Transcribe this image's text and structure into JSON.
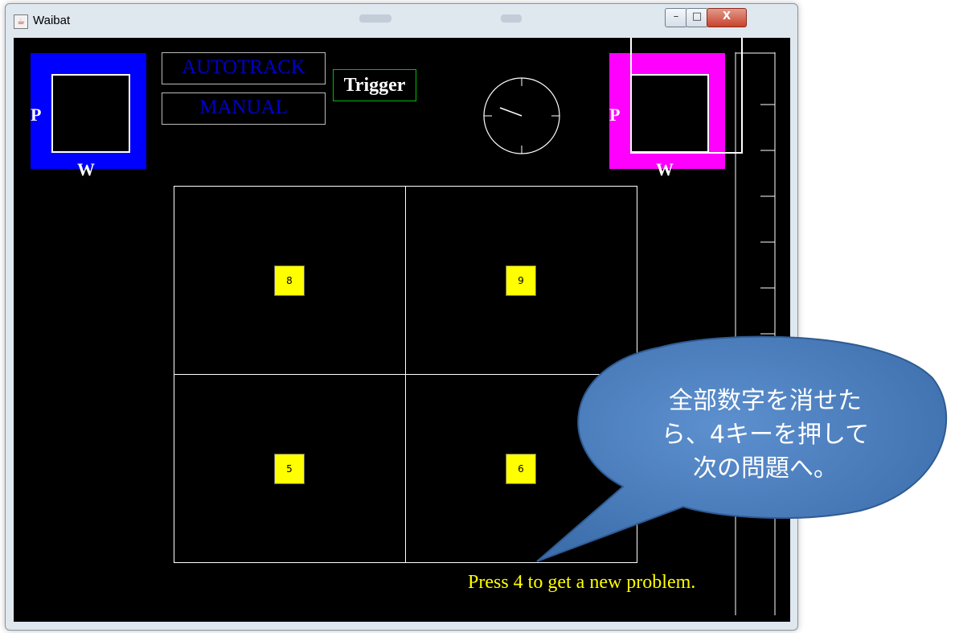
{
  "window": {
    "title": "Waibat",
    "controls": {
      "minimize": "–",
      "maximize": "□",
      "close": "X"
    }
  },
  "left_indicator": {
    "p_label": "P",
    "w_label": "W",
    "color": "#0000ff"
  },
  "right_indicator": {
    "p_label": "P",
    "w_label": "W",
    "color": "#ff00ff"
  },
  "modes": {
    "autotrack": "AUTOTRACK",
    "manual": "MANUAL",
    "trigger": "Trigger"
  },
  "grid": {
    "tiles": [
      {
        "label": "8"
      },
      {
        "label": "9"
      },
      {
        "label": "5"
      },
      {
        "label": "6"
      }
    ]
  },
  "status_message": "Press 4 to get a new problem.",
  "callout": {
    "lines": [
      "全部数字を消せた",
      "ら、4キーを押して",
      "次の問題へ。"
    ]
  },
  "colors": {
    "tile": "#ffff00",
    "status": "#ffff00",
    "callout_fill": "#4a7ebf"
  }
}
